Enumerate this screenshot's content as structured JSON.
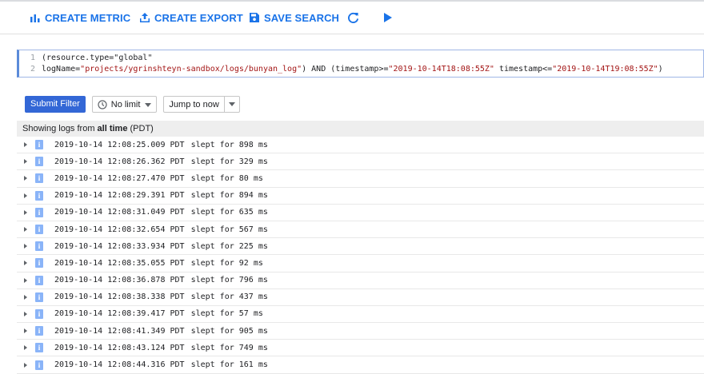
{
  "toolbar": {
    "create_metric": "CREATE METRIC",
    "create_export": "CREATE EXPORT",
    "save_search": "SAVE SEARCH"
  },
  "query": {
    "line1_num": "1",
    "line2_num": "2",
    "line1": "(resource.type=\"global\"",
    "line2_key": "logName=",
    "line2_logname": "\"projects/ygrinshteyn-sandbox/logs/bunyan_log\"",
    "line2_and": ") AND (timestamp>=",
    "line2_ts1": "\"2019-10-14T18:08:55Z\"",
    "line2_mid": " timestamp<=",
    "line2_ts2": "\"2019-10-14T19:08:55Z\"",
    "line2_end": ")"
  },
  "controls": {
    "submit": "Submit Filter",
    "limit": "No limit",
    "jump": "Jump to now"
  },
  "header": {
    "prefix": "Showing logs from ",
    "range": "all time",
    "suffix": " (PDT)"
  },
  "logs": [
    {
      "ts": "2019-10-14 12:08:25.009 PDT",
      "msg": "slept for 898 ms"
    },
    {
      "ts": "2019-10-14 12:08:26.362 PDT",
      "msg": "slept for 329 ms"
    },
    {
      "ts": "2019-10-14 12:08:27.470 PDT",
      "msg": "slept for 80 ms"
    },
    {
      "ts": "2019-10-14 12:08:29.391 PDT",
      "msg": "slept for 894 ms"
    },
    {
      "ts": "2019-10-14 12:08:31.049 PDT",
      "msg": "slept for 635 ms"
    },
    {
      "ts": "2019-10-14 12:08:32.654 PDT",
      "msg": "slept for 567 ms"
    },
    {
      "ts": "2019-10-14 12:08:33.934 PDT",
      "msg": "slept for 225 ms"
    },
    {
      "ts": "2019-10-14 12:08:35.055 PDT",
      "msg": "slept for 92 ms"
    },
    {
      "ts": "2019-10-14 12:08:36.878 PDT",
      "msg": "slept for 796 ms"
    },
    {
      "ts": "2019-10-14 12:08:38.338 PDT",
      "msg": "slept for 437 ms"
    },
    {
      "ts": "2019-10-14 12:08:39.417 PDT",
      "msg": "slept for 57 ms"
    },
    {
      "ts": "2019-10-14 12:08:41.349 PDT",
      "msg": "slept for 905 ms"
    },
    {
      "ts": "2019-10-14 12:08:43.124 PDT",
      "msg": "slept for 749 ms"
    },
    {
      "ts": "2019-10-14 12:08:44.316 PDT",
      "msg": "slept for 161 ms"
    }
  ],
  "severity_letter": "i",
  "colors": {
    "accent": "#1a73e8",
    "submit": "#3367d6",
    "info_badge": "#8ab4f8",
    "string": "#a31515"
  }
}
